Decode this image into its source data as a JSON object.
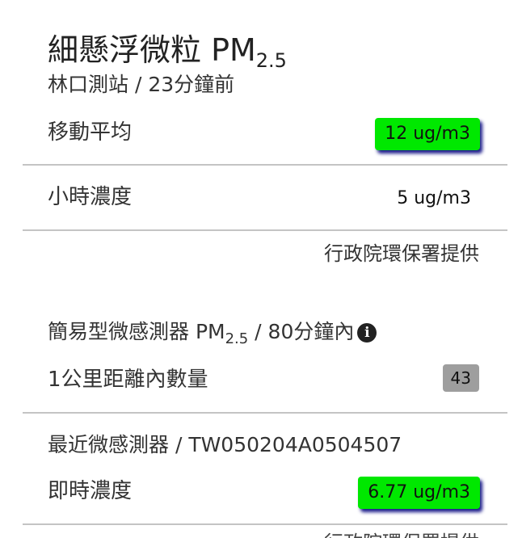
{
  "header": {
    "title_main": "細懸浮微粒 PM",
    "title_sub": "2.5",
    "subtitle": "林口測站 / 23分鐘前"
  },
  "station": {
    "moving_avg_label": "移動平均",
    "moving_avg_value": "12 ug/m3",
    "hourly_label": "小時濃度",
    "hourly_value": "5 ug/m3",
    "credit": "行政院環保署提供"
  },
  "sensors": {
    "heading_main": "簡易型微感測器 PM",
    "heading_sub": "2.5",
    "heading_suffix": " / 80分鐘內",
    "info_icon": "info-circle",
    "count_label": "1公里距離內數量",
    "count_value": "43",
    "nearest_label": "最近微感測器 / TW050204A0504507",
    "realtime_label": "即時濃度",
    "realtime_value": "6.77 ug/m3",
    "cutoff_text": "行政院環保署提供"
  },
  "colors": {
    "good_badge": "#00e800",
    "count_badge": "#9e9e9e",
    "divider": "#c4c4c4"
  }
}
